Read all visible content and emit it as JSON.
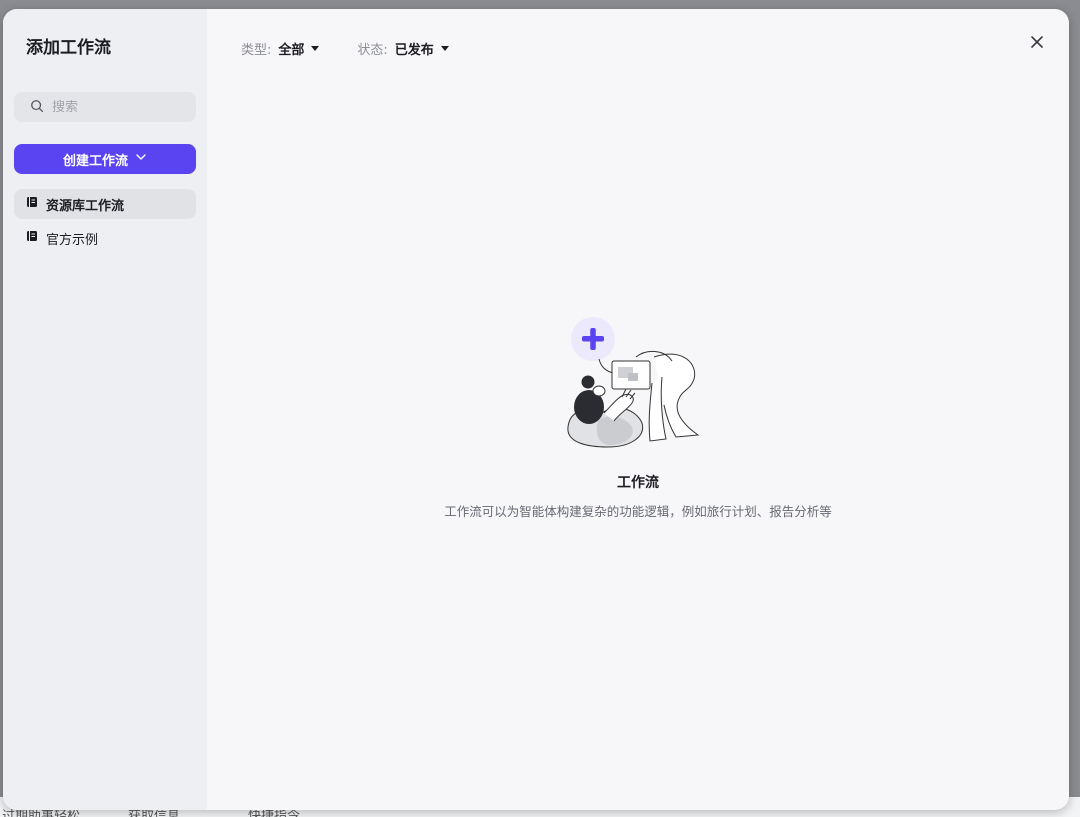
{
  "dialog": {
    "title": "添加工作流"
  },
  "sidebar": {
    "search": {
      "placeholder": "搜索",
      "value": ""
    },
    "create_button": {
      "label": "创建工作流"
    },
    "items": [
      {
        "label": "资源库工作流",
        "active": true
      },
      {
        "label": "官方示例",
        "active": false
      }
    ]
  },
  "filters": {
    "type": {
      "label": "类型:",
      "value": "全部"
    },
    "status": {
      "label": "状态:",
      "value": "已发布"
    }
  },
  "empty_state": {
    "title": "工作流",
    "description": "工作流可以为智能体构建复杂的功能逻辑，例如旅行计划、报告分析等"
  },
  "background": {
    "fragments": [
      "过期助事轻松",
      "获取信息",
      "快捷指令"
    ]
  },
  "colors": {
    "accent": "#5a43f1",
    "sidebar_bg": "#eeeff2",
    "main_bg": "#f7f7f9"
  },
  "icons": {
    "search": "search-icon",
    "chevron": "chevron-down-icon",
    "library": "library-icon",
    "close": "close-icon",
    "illustration": "empty-workflow-illustration"
  }
}
